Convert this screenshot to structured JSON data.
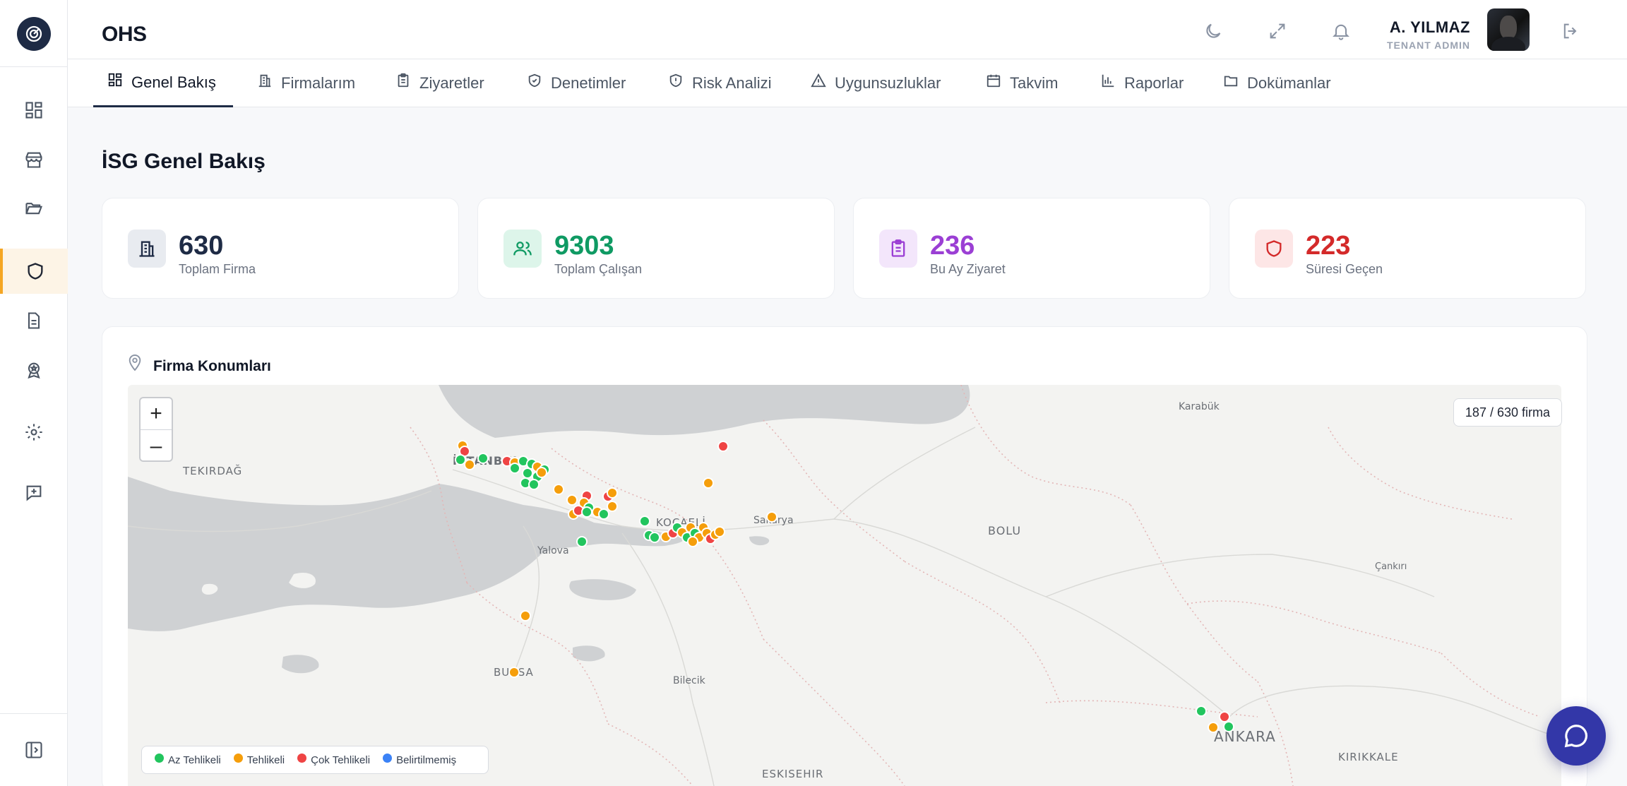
{
  "app": {
    "brand": "OHS"
  },
  "user": {
    "name": "A. YILMAZ",
    "role": "TENANT ADMIN"
  },
  "tabs": [
    {
      "label": "Genel Bakış",
      "icon": "dashboard-icon",
      "active": true
    },
    {
      "label": "Firmalarım",
      "icon": "building-icon"
    },
    {
      "label": "Ziyaretler",
      "icon": "clipboard-icon"
    },
    {
      "label": "Denetimler",
      "icon": "shield-check-icon"
    },
    {
      "label": "Risk Analizi",
      "icon": "shield-alert-icon"
    },
    {
      "label": "Uygunsuzluklar",
      "icon": "warning-triangle-icon"
    },
    {
      "label": "Takvim",
      "icon": "calendar-icon"
    },
    {
      "label": "Raporlar",
      "icon": "bar-chart-icon"
    },
    {
      "label": "Dokümanlar",
      "icon": "folder-icon"
    }
  ],
  "page": {
    "title": "İSG Genel Bakış"
  },
  "stats": [
    {
      "value": "630",
      "label": "Toplam Firma",
      "color": "#1e2b45",
      "bg": "#e8ebf0"
    },
    {
      "value": "9303",
      "label": "Toplam Çalışan",
      "color": "#0f9a63",
      "bg": "#ddf5ea"
    },
    {
      "value": "236",
      "label": "Bu Ay Ziyaret",
      "color": "#9b3fd4",
      "bg": "#f3e6fb"
    },
    {
      "value": "223",
      "label": "Süresi Geçen",
      "color": "#d42a2a",
      "bg": "#fde6e6"
    }
  ],
  "map": {
    "title": "Firma Konumları",
    "count": "187 / 630 firma",
    "zoom_in": "+",
    "zoom_out": "–",
    "place_labels": [
      "TEKIRDAĞ",
      "İSTANBUL",
      "KOCAELİ",
      "Yalova",
      "Sakarya",
      "BOLU",
      "Karabük",
      "Çankırı",
      "BURSA",
      "Bilecik",
      "ANKARA",
      "KIRIKKALE",
      "ESKISEHIR"
    ],
    "legend": [
      {
        "label": "Az Tehlikeli",
        "color": "#22c55e"
      },
      {
        "label": "Tehlikeli",
        "color": "#f59e0b"
      },
      {
        "label": "Çok Tehlikeli",
        "color": "#ef4444"
      },
      {
        "label": "Belirtilmemiş",
        "color": "#3b82f6"
      }
    ]
  }
}
